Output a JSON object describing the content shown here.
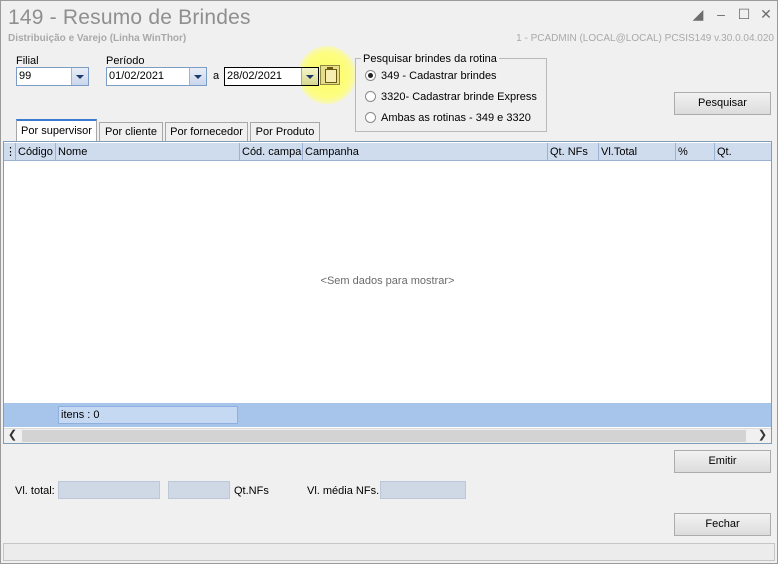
{
  "window": {
    "title": "149 - Resumo de Brindes",
    "subtitle": "Distribuição e Varejo (Linha WinThor)",
    "session": "1 - PCADMIN (LOCAL@LOCAL)   PCSIS149  v.30.0.04.020"
  },
  "filters": {
    "filial_label": "Filial",
    "filial_value": "99",
    "periodo_label": "Período",
    "date_from": "01/02/2021",
    "separator": "a",
    "date_to": "28/02/2021"
  },
  "rotina": {
    "group_title": "Pesquisar brindes da rotina",
    "options": [
      {
        "label": "349 - Cadastrar brindes",
        "selected": true
      },
      {
        "label": "3320- Cadastrar brinde Express",
        "selected": false
      },
      {
        "label": "Ambas as rotinas - 349 e 3320",
        "selected": false
      }
    ]
  },
  "buttons": {
    "pesquisar": "Pesquisar",
    "emitir": "Emitir",
    "fechar": "Fechar"
  },
  "tabs": [
    {
      "label": "Por supervisor",
      "active": true
    },
    {
      "label": "Por cliente",
      "active": false
    },
    {
      "label": "Por fornecedor",
      "active": false
    },
    {
      "label": "Por Produto",
      "active": false
    }
  ],
  "grid": {
    "columns": [
      "Código",
      "Nome",
      "Cód. campai",
      "Campanha",
      "Qt. NFs",
      "Vl.Total",
      "%",
      "Qt."
    ],
    "empty_text": "<Sem dados para mostrar>",
    "footer_items": "itens : 0"
  },
  "totals": {
    "vl_total_label": "Vl. total:",
    "qt_nfs_label": "Qt.NFs",
    "vl_media_label": "Vl. média NFs.:"
  },
  "colors": {
    "grid_header": "#cfdcee",
    "grid_footer": "#a7c4ea",
    "highlight": "#ffff5a"
  }
}
